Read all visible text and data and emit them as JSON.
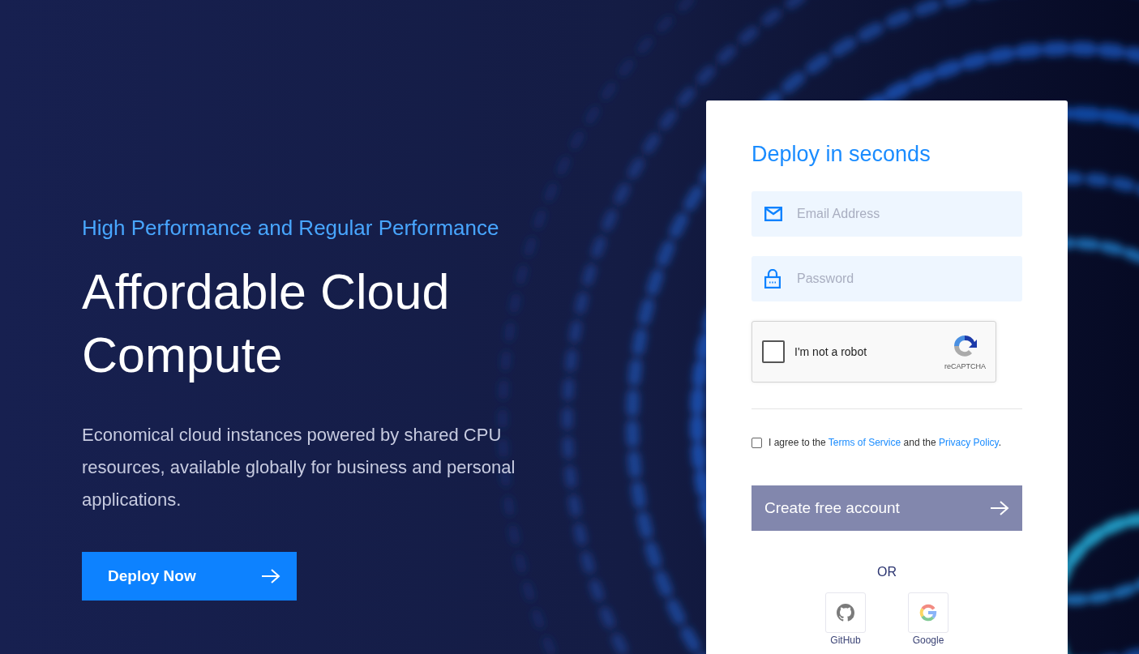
{
  "hero": {
    "subtitle": "High Performance and Regular Performance",
    "title": "Affordable Cloud Compute",
    "description": "Economical cloud instances powered by shared CPU resources, available globally for business and personal applications.",
    "button": "Deploy Now"
  },
  "signup": {
    "title": "Deploy in seconds",
    "fields": [
      {
        "kind": "email",
        "placeholder": "Email Address"
      },
      {
        "kind": "password",
        "placeholder": "Password"
      }
    ],
    "captcha": {
      "label": "I'm not a robot",
      "brand": "reCAPTCHA",
      "checked": false
    },
    "agreement": {
      "checked": false,
      "segments": [
        {
          "kind": "text",
          "text": "I agree to the "
        },
        {
          "kind": "link",
          "text": "Terms of Service"
        },
        {
          "kind": "text",
          "text": " and the "
        },
        {
          "kind": "link",
          "text": "Privacy Policy"
        },
        {
          "kind": "text",
          "text": "."
        }
      ]
    },
    "submit": "Create free account",
    "divider": "OR",
    "social": [
      {
        "kind": "github",
        "label": "GitHub"
      },
      {
        "kind": "google",
        "label": "Google"
      }
    ]
  }
}
